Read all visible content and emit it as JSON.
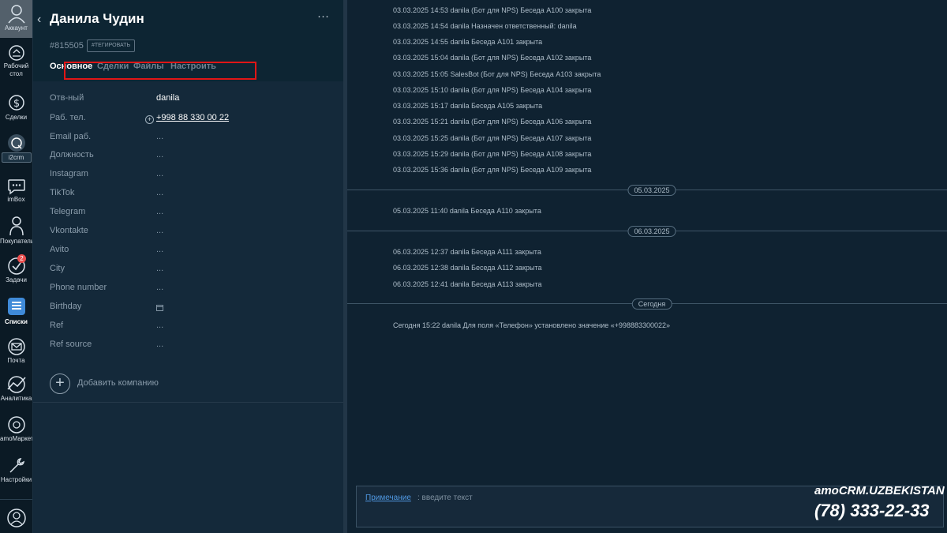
{
  "nav": {
    "account": "Аккаунт",
    "desk_line1": "Рабочий",
    "desk_line2": "стол",
    "deals": "Сделки",
    "i2crm": "i2crm",
    "imbox": "imBox",
    "buyers": "Покупатели",
    "tasks": "Задачи",
    "tasks_badge": "2",
    "lists": "Списки",
    "mail": "Почта",
    "analytics": "Аналитика",
    "market": "amoМаркет",
    "settings": "Настройки"
  },
  "card": {
    "title": "Данила Чудин",
    "id": "#815505",
    "tag_button": "#ТЕГИРОВАТЬ",
    "more": "···",
    "tabs": [
      "Основное",
      "Сделки",
      "Файлы",
      "Настроить"
    ],
    "fields": [
      {
        "label": "Отв-ный",
        "value": "danila"
      },
      {
        "label": "Раб. тел.",
        "value": "+998 88 330 00 22"
      },
      {
        "label": "Email раб.",
        "value": "..."
      },
      {
        "label": "Должность",
        "value": "..."
      },
      {
        "label": "Instagram",
        "value": "..."
      },
      {
        "label": "TikTok",
        "value": "..."
      },
      {
        "label": "Telegram",
        "value": "..."
      },
      {
        "label": "Vkontakte",
        "value": "..."
      },
      {
        "label": "Avito",
        "value": "..."
      },
      {
        "label": "City",
        "value": "..."
      },
      {
        "label": "Phone number",
        "value": "..."
      },
      {
        "label": "Birthday",
        "value": ""
      },
      {
        "label": "Ref",
        "value": "..."
      },
      {
        "label": "Ref source",
        "value": "..."
      }
    ],
    "add_company": "Добавить компанию"
  },
  "feed": {
    "events_0303": [
      "03.03.2025 14:53 danila (Бот для NPS) Беседа A100 закрыта",
      "03.03.2025 14:54 danila Назначен ответственный: danila",
      "03.03.2025 14:55 danila Беседа A101 закрыта",
      "03.03.2025 15:04 danila (Бот для NPS) Беседа A102 закрыта",
      "03.03.2025 15:05 SalesBot (Бот для NPS) Беседа A103 закрыта",
      "03.03.2025 15:10 danila (Бот для NPS) Беседа A104 закрыта",
      "03.03.2025 15:17 danila Беседа A105 закрыта",
      "03.03.2025 15:21 danila (Бот для NPS) Беседа A106 закрыта",
      "03.03.2025 15:25 danila (Бот для NPS) Беседа A107 закрыта",
      "03.03.2025 15:29 danila (Бот для NPS) Беседа A108 закрыта",
      "03.03.2025 15:36 danila (Бот для NPS) Беседа A109 закрыта"
    ],
    "sep_1": "05.03.2025",
    "events_0503": [
      "05.03.2025 11:40 danila Беседа A110 закрыта"
    ],
    "sep_2": "06.03.2025",
    "events_0603": [
      "06.03.2025 12:37 danila Беседа A111 закрыта",
      "06.03.2025 12:38 danila Беседа A112 закрыта",
      "06.03.2025 12:41 danila Беседа A113 закрыта"
    ],
    "sep_3": "Сегодня",
    "events_today": [
      "Сегодня 15:22 danila Для поля «Телефон» установлено значение «+998883300022»"
    ]
  },
  "note": {
    "link": "Примечание",
    "placeholder": ": введите текст"
  },
  "brand": {
    "logo": "amoCRM.UZBEKISTAN",
    "phone": "(78) 333-22-33"
  },
  "colors": {
    "background": "#0f2231",
    "panel": "#14293a",
    "highlight_frame": "#e01616",
    "badge": "#e94d4d",
    "link": "#4f97e0"
  }
}
